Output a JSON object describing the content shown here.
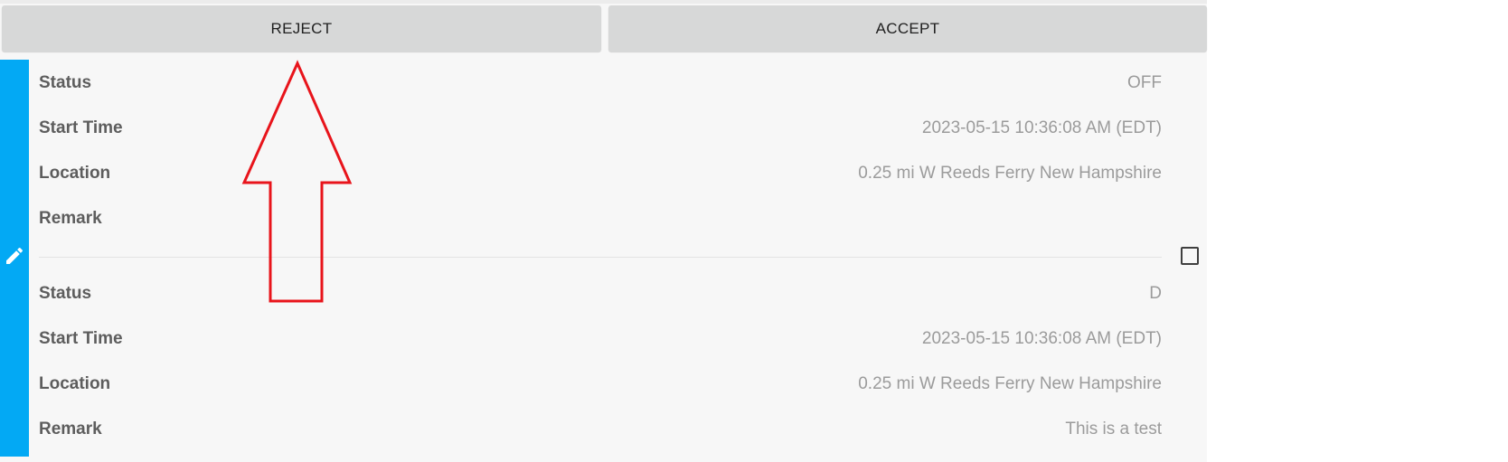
{
  "actions": {
    "reject_label": "REJECT",
    "accept_label": "ACCEPT"
  },
  "records": [
    {
      "rows": [
        {
          "label": "Status",
          "value": "OFF"
        },
        {
          "label": "Start Time",
          "value": "2023-05-15 10:36:08 AM (EDT)"
        },
        {
          "label": "Location",
          "value": "0.25 mi W Reeds Ferry New Hampshire"
        },
        {
          "label": "Remark",
          "value": ""
        }
      ]
    },
    {
      "rows": [
        {
          "label": "Status",
          "value": "D"
        },
        {
          "label": "Start Time",
          "value": "2023-05-15 10:36:08 AM (EDT)"
        },
        {
          "label": "Location",
          "value": "0.25 mi W Reeds Ferry New Hampshire"
        },
        {
          "label": "Remark",
          "value": "This is a test"
        }
      ]
    }
  ],
  "icons": {
    "edit": "pencil-icon",
    "select": "checkbox"
  },
  "colors": {
    "accent": "#03a9f4",
    "annotation": "#e8141b",
    "button_bg": "#d7d8d8"
  }
}
